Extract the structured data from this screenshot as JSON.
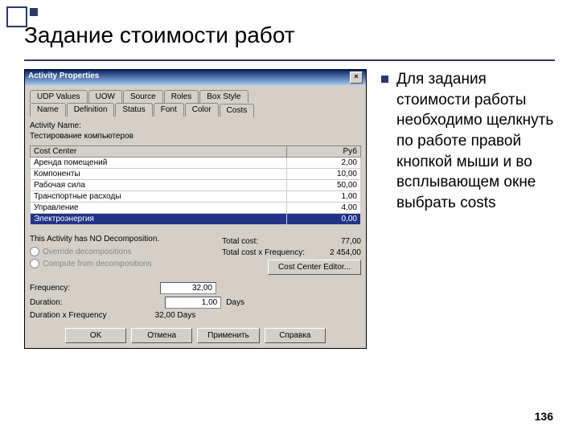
{
  "slide": {
    "title": "Задание стоимости работ",
    "pagenum": "136"
  },
  "sidebar": {
    "text": "Для задания стоимости работы необходимо щелкнуть по работе правой кнопкой мыши и во всплывающем окне выбрать costs"
  },
  "win": {
    "title": "Activity Properties",
    "tabs1": [
      "UDP Values",
      "UOW",
      "Source",
      "Roles",
      "Box Style"
    ],
    "tabs2": [
      "Name",
      "Definition",
      "Status",
      "Font",
      "Color",
      "Costs"
    ],
    "activity_lbl": "Activity Name:",
    "activity_val": "Тестирование компьютеров",
    "th1": "Cost Center",
    "th2": "Руб",
    "rows": [
      {
        "n": "Аренда помещений",
        "v": "2,00"
      },
      {
        "n": "Компоненты",
        "v": "10,00"
      },
      {
        "n": "Рабочая сила",
        "v": "50,00"
      },
      {
        "n": "Транспортные расходы",
        "v": "1,00"
      },
      {
        "n": "Управление",
        "v": "4,00"
      },
      {
        "n": "Электроэнергия",
        "v": "0,00"
      }
    ],
    "decomp": "This Activity has NO Decomposition.",
    "r1": "Override decompositions",
    "r2": "Compute from decompositions",
    "tc_lbl": "Total cost:",
    "tc_val": "77,00",
    "tcf_lbl": "Total cost x Frequency:",
    "tcf_val": "2 454,00",
    "cce": "Cost Center Editor...",
    "freq_lbl": "Frequency:",
    "freq_val": "32,00",
    "dur_lbl": "Duration:",
    "dur_val": "1,00",
    "dur_unit": "Days",
    "dxf_lbl": "Duration x Frequency",
    "dxf_val": "32,00 Days",
    "b_ok": "OK",
    "b_cancel": "Отмена",
    "b_apply": "Применить",
    "b_help": "Справка"
  }
}
